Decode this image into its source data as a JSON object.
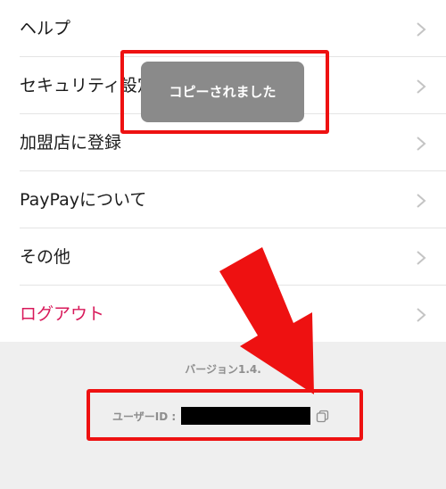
{
  "menu": {
    "items": [
      {
        "label": "ヘルプ"
      },
      {
        "label": "セキュリティ設定"
      },
      {
        "label": "加盟店に登録"
      },
      {
        "label": "PayPayについて"
      },
      {
        "label": "その他"
      },
      {
        "label": "ログアウト"
      }
    ]
  },
  "footer": {
    "version_label": "バージョン1.4.",
    "userid_label": "ユーザーID :"
  },
  "toast": {
    "message": "コピーされました"
  },
  "icons": {
    "chevron": "chevron-right-icon",
    "copy": "copy-icon"
  },
  "colors": {
    "logout": "#d8195a",
    "annotation": "#ee1111",
    "toast_bg": "#8a8a8a"
  }
}
